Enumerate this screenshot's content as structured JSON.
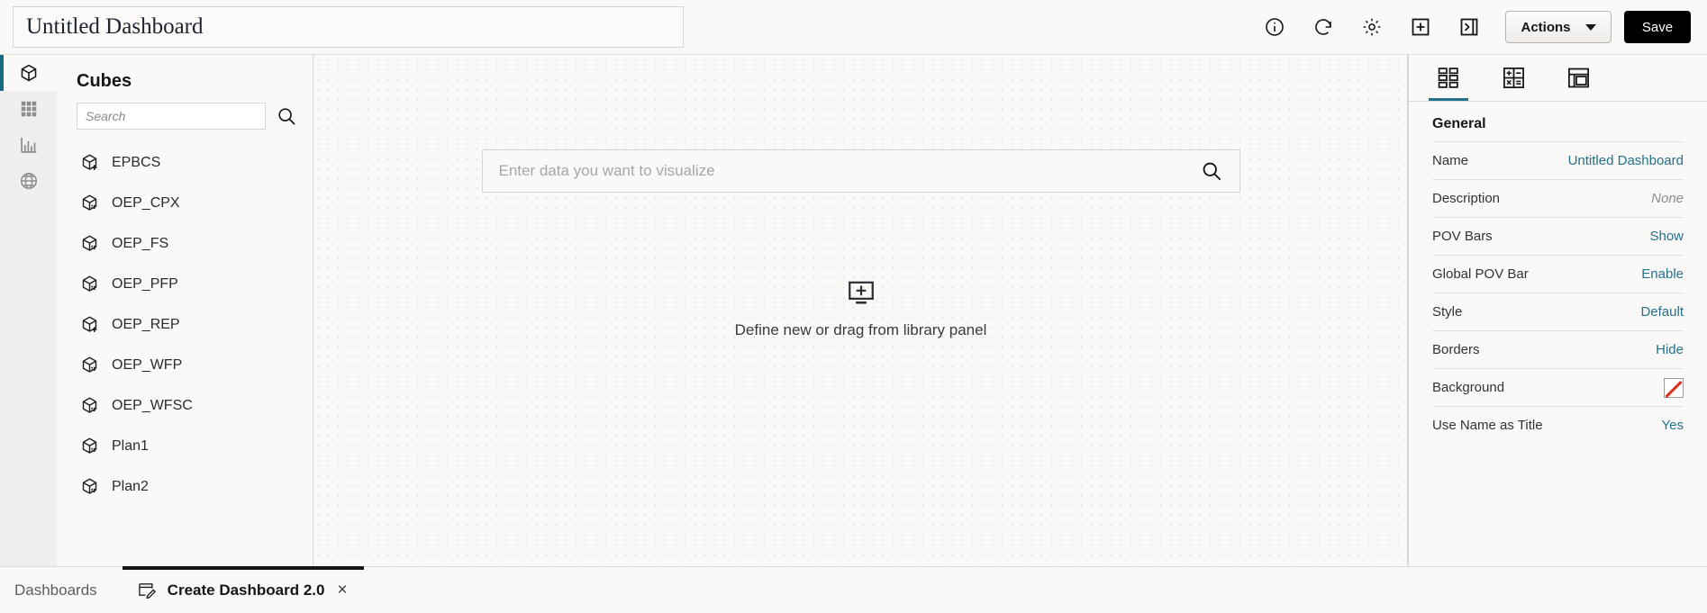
{
  "topbar": {
    "title_value": "Untitled Dashboard",
    "title_placeholder": "Untitled Dashboard",
    "icons": [
      {
        "name": "info-icon",
        "label": "Info"
      },
      {
        "name": "refresh-icon",
        "label": "Refresh"
      },
      {
        "name": "gear-icon",
        "label": "Settings"
      },
      {
        "name": "add-panel-icon",
        "label": "Add"
      },
      {
        "name": "collapse-panel-icon",
        "label": "Collapse Panel"
      }
    ],
    "actions_label": "Actions",
    "save_label": "Save"
  },
  "rail": {
    "items": [
      {
        "name": "rail-item-cubes",
        "icon": "cube-icon",
        "label": "Cubes",
        "active": true
      },
      {
        "name": "rail-item-forms",
        "icon": "grid-icon",
        "label": "Forms",
        "active": false
      },
      {
        "name": "rail-item-charts",
        "icon": "bar-chart-icon",
        "label": "Charts",
        "active": false
      },
      {
        "name": "rail-item-global",
        "icon": "globe-icon",
        "label": "Global",
        "active": false
      }
    ]
  },
  "library": {
    "title": "Cubes",
    "search_placeholder": "Search",
    "search_value": "",
    "items": [
      {
        "label": "EPBCS",
        "icon": "cube-add-icon"
      },
      {
        "label": "OEP_CPX",
        "icon": "cube-grid-icon"
      },
      {
        "label": "OEP_FS",
        "icon": "cube-grid-icon"
      },
      {
        "label": "OEP_PFP",
        "icon": "cube-grid-icon"
      },
      {
        "label": "OEP_REP",
        "icon": "cube-add-icon"
      },
      {
        "label": "OEP_WFP",
        "icon": "cube-grid-icon"
      },
      {
        "label": "OEP_WFSC",
        "icon": "cube-grid-icon"
      },
      {
        "label": "Plan1",
        "icon": "cube-grid-icon"
      },
      {
        "label": "Plan2",
        "icon": "cube-grid-icon"
      }
    ]
  },
  "canvas": {
    "viz_search_placeholder": "Enter data you want to visualize",
    "viz_search_value": "",
    "dropzone_label": "Define new or drag from library panel"
  },
  "properties": {
    "tabs": [
      {
        "name": "tab-general",
        "icon": "layout-blocks-icon",
        "active": true
      },
      {
        "name": "tab-calculation",
        "icon": "calculator-icon",
        "active": false
      },
      {
        "name": "tab-layout",
        "icon": "panel-layout-icon",
        "active": false
      }
    ],
    "section_title": "General",
    "rows": [
      {
        "key": "Name",
        "value": "Untitled Dashboard",
        "kind": "link"
      },
      {
        "key": "Description",
        "value": "None",
        "kind": "muted"
      },
      {
        "key": "POV Bars",
        "value": "Show",
        "kind": "link"
      },
      {
        "key": "Global POV Bar",
        "value": "Enable",
        "kind": "link"
      },
      {
        "key": "Style",
        "value": "Default",
        "kind": "link"
      },
      {
        "key": "Borders",
        "value": "Hide",
        "kind": "link"
      },
      {
        "key": "Background",
        "value": "",
        "kind": "swatch"
      },
      {
        "key": "Use Name as Title",
        "value": "Yes",
        "kind": "link"
      }
    ]
  },
  "bottom": {
    "breadcrumb": "Dashboards",
    "tab_label": "Create Dashboard 2.0",
    "tab_icon": "edit-dashboard-icon",
    "close_glyph": "×"
  },
  "colors": {
    "accent_teal": "#186a80",
    "link_teal": "#23718c",
    "app_bg": "#faf9f8",
    "swatch_red": "#e02b20",
    "save_bg": "#000000"
  }
}
